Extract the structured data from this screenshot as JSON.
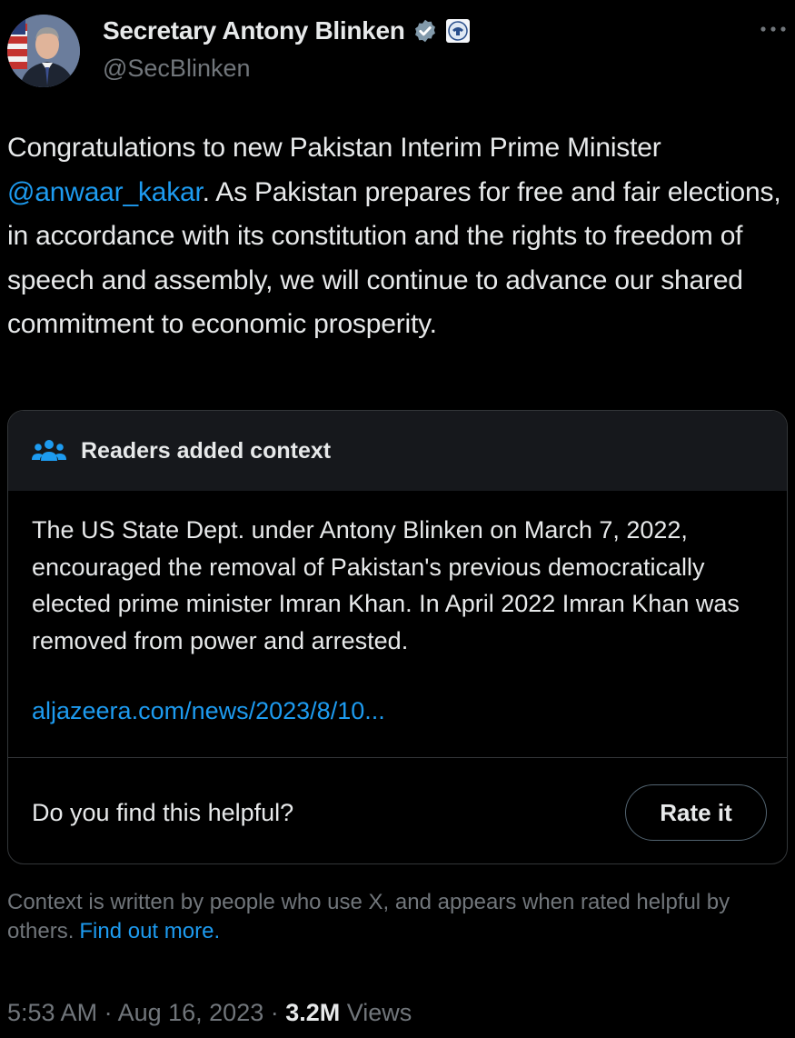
{
  "author": {
    "display_name": "Secretary Antony Blinken",
    "handle": "@SecBlinken",
    "verified_icon": "verified-badge-icon",
    "affiliation_icon": "state-department-seal-icon"
  },
  "tweet": {
    "text_before_mention": "Congratulations to new Pakistan Interim Prime Minister ",
    "mention": "@anwaar_kakar",
    "text_after_mention": ". As Pakistan prepares for free and fair elections, in accordance with its constitution and the rights to freedom of speech and assembly, we will continue to advance our shared commitment to economic prosperity."
  },
  "community_note": {
    "header_icon": "people-group-icon",
    "title": "Readers added context",
    "body": "The US State Dept. under Antony Blinken on March 7, 2022, encouraged the removal of Pakistan's previous democratically elected prime minister Imran Khan. In April 2022 Imran Khan was removed from power and arrested.",
    "link": "aljazeera.com/news/2023/8/10...",
    "helpful_question": "Do you find this helpful?",
    "rate_button": "Rate it"
  },
  "context_info": {
    "text": "Context is written by people who use X, and appears when rated helpful by others.",
    "link": "Find out more."
  },
  "meta": {
    "time": "5:53 AM",
    "separator": " · ",
    "date": "Aug 16, 2023",
    "views_count": "3.2M",
    "views_label": " Views"
  },
  "colors": {
    "background": "#000000",
    "text": "#e7e9ea",
    "secondary_text": "#71767b",
    "link": "#1d9bf0",
    "verified": "#829aab",
    "card_header": "#16181c",
    "border": "#333639"
  }
}
